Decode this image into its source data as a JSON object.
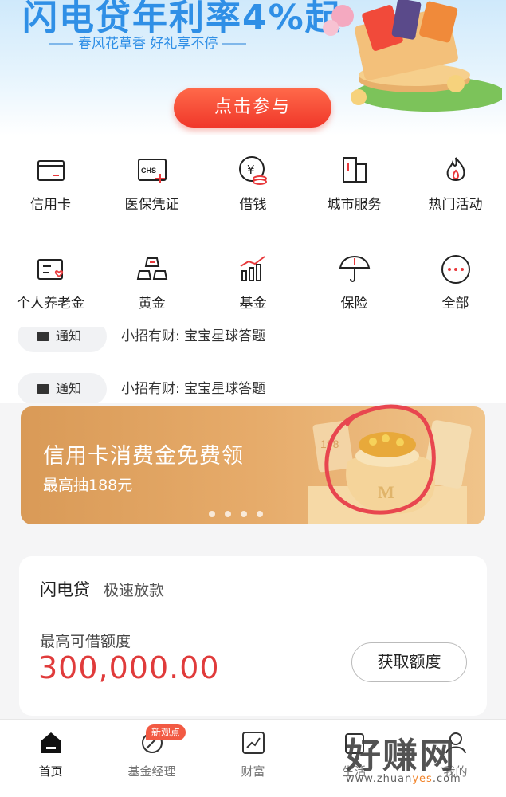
{
  "banner": {
    "title": "闪电贷年利率4%起",
    "subtitle": "春风花草香 好礼享不停",
    "cta_label": "点击参与"
  },
  "grid": {
    "items": [
      {
        "label": "信用卡",
        "icon": "credit-card-icon"
      },
      {
        "label": "医保凭证",
        "icon": "medical-insurance-icon"
      },
      {
        "label": "借钱",
        "icon": "borrow-money-icon"
      },
      {
        "label": "城市服务",
        "icon": "city-service-icon"
      },
      {
        "label": "热门活动",
        "icon": "flame-icon"
      },
      {
        "label": "个人养老金",
        "icon": "pension-icon"
      },
      {
        "label": "黄金",
        "icon": "gold-bars-icon"
      },
      {
        "label": "基金",
        "icon": "fund-chart-icon"
      },
      {
        "label": "保险",
        "icon": "umbrella-icon"
      },
      {
        "label": "全部",
        "icon": "more-dots-icon"
      }
    ]
  },
  "notices": [
    {
      "tag": "通知",
      "text": "小招有财: 宝宝星球答题"
    },
    {
      "tag": "通知",
      "text": "小招有财: 宝宝星球答题"
    }
  ],
  "promo": {
    "title": "信用卡消费金免费领",
    "subtitle": "最高抽188元",
    "badge_number": "188",
    "coin_mark": "M"
  },
  "loan": {
    "name": "闪电贷",
    "tag": "极速放款",
    "limit_label": "最高可借额度",
    "amount": "300,000.00",
    "button_label": "获取额度"
  },
  "tabbar": {
    "items": [
      {
        "label": "首页",
        "icon": "home-icon",
        "active": true
      },
      {
        "label": "基金经理",
        "icon": "fund-manager-icon",
        "badge": "新观点"
      },
      {
        "label": "财富",
        "icon": "wealth-chart-icon"
      },
      {
        "label": "生活",
        "icon": "life-icon"
      },
      {
        "label": "我的",
        "icon": "profile-icon"
      }
    ]
  },
  "watermark": {
    "main": "好赚网",
    "domain_a": "www.zhuan",
    "domain_b": "yes",
    "domain_c": ".com"
  },
  "colors": {
    "primary_red": "#f0372a",
    "amount_red": "#e03b3b",
    "banner_blue": "#2f8fe6",
    "promo_gold": "#e6ab6a"
  }
}
